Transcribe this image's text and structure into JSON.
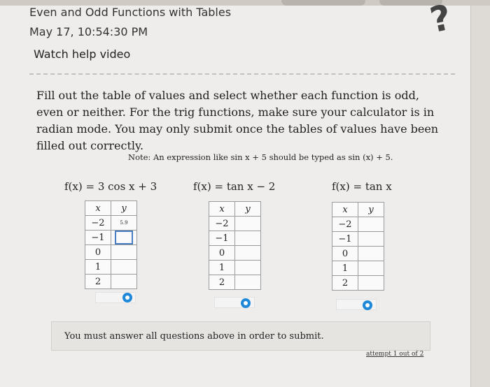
{
  "header": {
    "title": "Even and Odd Functions with Tables",
    "datetime": "May 17, 10:54:30 PM",
    "help_link": "Watch help video"
  },
  "instructions": "Fill out the table of values and select whether each function is odd, even or neither. For the trig functions, make sure your calculator is in radian mode. You may only submit once the tables of values have been filled out correctly.",
  "note": "Note: An expression like sin x + 5 should be typed as sin (x) + 5.",
  "tables": [
    {
      "function_label": "f(x) = 3 cos x + 3",
      "col_x": "x",
      "col_y": "y",
      "rows": [
        {
          "x": "−2",
          "y": "5.9"
        },
        {
          "x": "−1",
          "y": ""
        },
        {
          "x": "0",
          "y": ""
        },
        {
          "x": "1",
          "y": ""
        },
        {
          "x": "2",
          "y": ""
        }
      ]
    },
    {
      "function_label": "f(x) = tan x − 2",
      "col_x": "x",
      "col_y": "y",
      "rows": [
        {
          "x": "−2",
          "y": ""
        },
        {
          "x": "−1",
          "y": ""
        },
        {
          "x": "0",
          "y": ""
        },
        {
          "x": "1",
          "y": ""
        },
        {
          "x": "2",
          "y": ""
        }
      ]
    },
    {
      "function_label": "f(x) = tan x",
      "col_x": "x",
      "col_y": "y",
      "rows": [
        {
          "x": "−2",
          "y": ""
        },
        {
          "x": "−1",
          "y": ""
        },
        {
          "x": "0",
          "y": ""
        },
        {
          "x": "1",
          "y": ""
        },
        {
          "x": "2",
          "y": ""
        }
      ]
    }
  ],
  "submit_message": "You must answer all questions above in order to submit.",
  "attempt_text": "attempt 1 out of 2",
  "colors": {
    "accent": "#1f88d8",
    "focus_border": "#4a7dc4"
  }
}
